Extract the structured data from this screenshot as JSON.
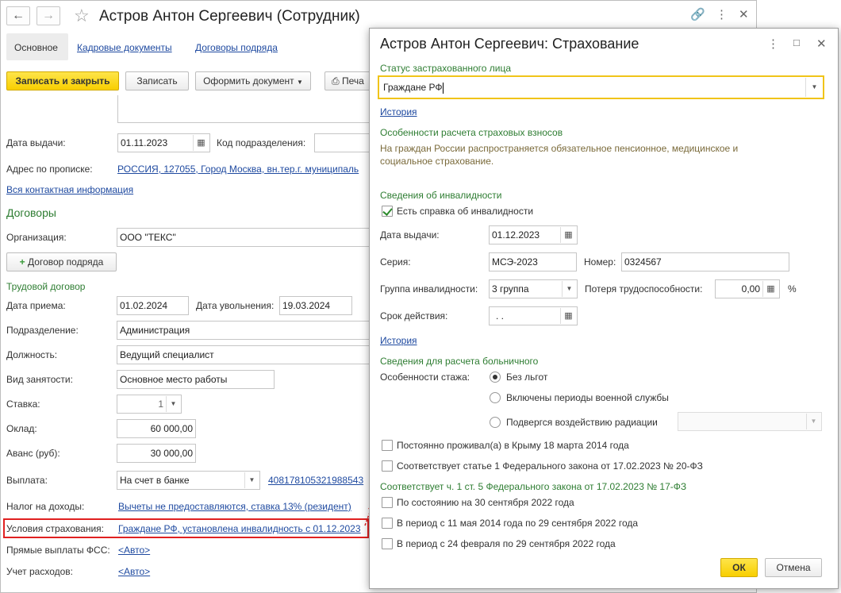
{
  "employee": {
    "title": "Астров Антон Сергеевич (Сотрудник)",
    "tabs": [
      "Основное",
      "Кадровые документы",
      "Договоры подряда"
    ],
    "toolbar": {
      "save_close": "Записать и закрыть",
      "save": "Записать",
      "make_doc": "Оформить документ",
      "print": "Печа"
    },
    "issue_date_label": "Дата выдачи:",
    "issue_date": "01.11.2023",
    "dept_code_label": "Код подразделения:",
    "address_label": "Адрес по прописке:",
    "address": "РОССИЯ, 127055, Город Москва, вн.тер.г. муниципаль",
    "contacts_link": "Вся контактная информация",
    "contracts_heading": "Договоры",
    "org_label": "Организация:",
    "org": "ООО \"ТЕКС\"",
    "contract_btn": "Договор подряда",
    "labor_heading": "Трудовой договор",
    "hire_label": "Дата приема:",
    "hire_date": "01.02.2024",
    "fire_label": "Дата увольнения:",
    "fire_date": "19.03.2024",
    "dept_label": "Подразделение:",
    "dept": "Администрация",
    "position_label": "Должность:",
    "position": "Ведущий специалист",
    "employment_label": "Вид занятости:",
    "employment": "Основное место работы",
    "rate_label": "Ставка:",
    "rate": "1",
    "salary_label": "Оклад:",
    "salary": "60 000,00",
    "advance_label": "Аванс (руб):",
    "advance": "30 000,00",
    "payment_label": "Выплата:",
    "payment": "На счет в банке",
    "account": "408178105321988543",
    "tax_label": "Налог на доходы:",
    "tax": "Вычеты не предоставляются, ставка 13% (резидент)",
    "insurance_label": "Условия страхования:",
    "insurance": "Граждане РФ, установлена инвалидность с 01.12.2023",
    "fss_label": "Прямые выплаты ФСС:",
    "fss": "<Авто>",
    "costs_label": "Учет расходов:",
    "costs": "<Авто>"
  },
  "dialog": {
    "title": "Астров Антон Сергеевич: Страхование",
    "status_label": "Статус застрахованного лица",
    "status": "Граждане РФ",
    "history1": "История",
    "features_heading": "Особенности расчета страховых взносов",
    "features_text1": "На граждан России распространяется обязательное пенсионное, медицинское и",
    "features_text2": "социальное страхование.",
    "disability_heading": "Сведения об инвалидности",
    "has_certificate": "Есть справка об инвалидности",
    "issue_date_label": "Дата выдачи:",
    "issue_date": "01.12.2023",
    "series_label": "Серия:",
    "series": "МСЭ-2023",
    "number_label": "Номер:",
    "number": "0324567",
    "group_label": "Группа инвалидности:",
    "group": "3 группа",
    "loss_label": "Потеря трудоспособности:",
    "loss": "0,00",
    "percent": "%",
    "validity_label": "Срок действия:",
    "validity": " .  .",
    "history2": "История",
    "sick_heading": "Сведения для расчета больничного",
    "exp_label": "Особенности стажа:",
    "radio": [
      "Без льгот",
      "Включены периоды военной службы",
      "Подвергся воздействию радиации"
    ],
    "crimea": "Постоянно проживал(а) в Крыму 18 марта 2014 года",
    "law20": "Соответствует статье 1 Федерального закона от 17.02.2023 № 20-ФЗ",
    "law17_heading": "Соответствует ч. 1 ст. 5 Федерального закона от 17.02.2023 № 17-ФЗ",
    "opt1": "По состоянию на 30 сентября 2022 года",
    "opt2": "В период с 11 мая 2014 года по 29 сентября 2022 года",
    "opt3": "В период с 24 февраля по 29 сентября 2022 года",
    "ok": "ОК",
    "cancel": "Отмена"
  }
}
